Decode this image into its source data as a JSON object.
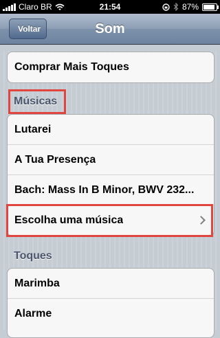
{
  "status_bar": {
    "carrier": "Claro BR",
    "time": "21:54",
    "battery": "87%",
    "battery_level": 0.87
  },
  "nav": {
    "back_label": "Voltar",
    "title": "Som"
  },
  "top_group": [
    {
      "label": "Comprar Mais Toques"
    }
  ],
  "musicas": {
    "header": "Músicas",
    "items": [
      {
        "label": "Lutarei"
      },
      {
        "label": "A Tua Presença"
      },
      {
        "label": "Bach: Mass In B Minor, BWV 232..."
      },
      {
        "label": "Escolha uma música"
      }
    ]
  },
  "toques": {
    "header": "Toques",
    "items": [
      {
        "label": "Marimba"
      },
      {
        "label": "Alarme"
      }
    ]
  },
  "colors": {
    "highlight": "#e0453f",
    "background": "#c5ccd4",
    "header_text": "#4c566c"
  },
  "icons": {
    "back": "back-arrow-icon",
    "disclosure": "chevron-right-icon",
    "wifi": "wifi-icon",
    "lock": "rotation-lock-icon",
    "bluetooth": "bluetooth-icon",
    "battery": "battery-icon"
  }
}
